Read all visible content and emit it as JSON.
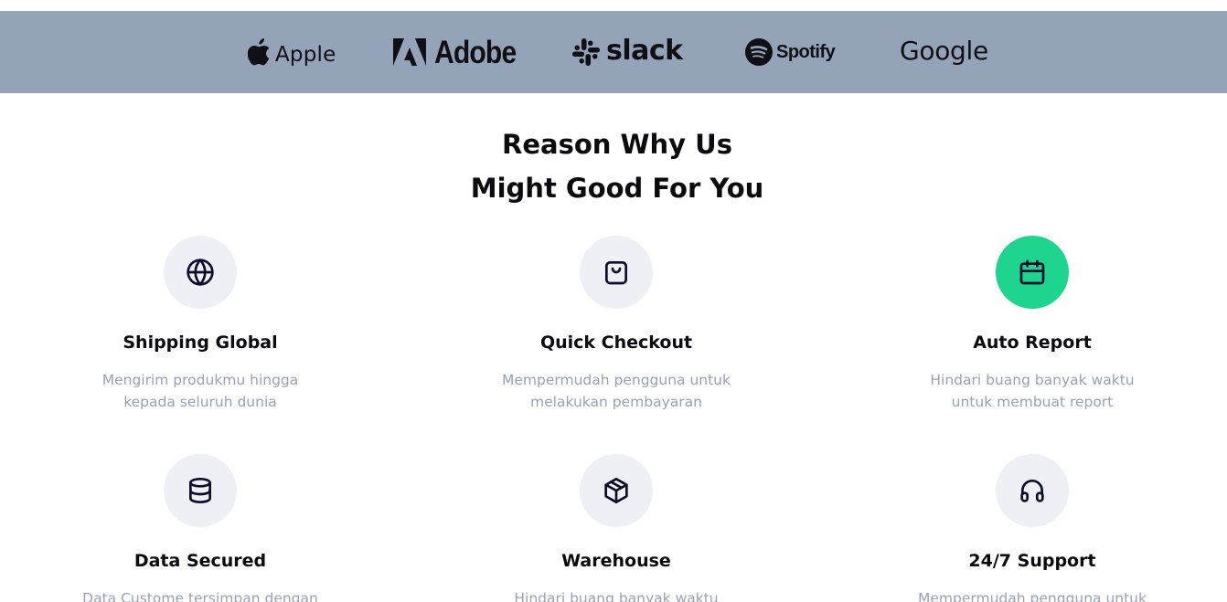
{
  "brands": {
    "apple": {
      "name": "Apple",
      "icon": "apple-logo-icon"
    },
    "adobe": {
      "name": "Adobe",
      "icon": "adobe-logo-icon"
    },
    "slack": {
      "name": "slack",
      "icon": "slack-logo-icon"
    },
    "spotify": {
      "name": "Spotify",
      "icon": "spotify-logo-icon"
    },
    "google": {
      "name": "Google"
    }
  },
  "section": {
    "title_line1": "Reason Why Us",
    "title_line2": "Might Good For You"
  },
  "features": [
    {
      "title": "Shipping Global",
      "desc_line1": "Mengirim produkmu hingga",
      "desc_line2": "kepada seluruh dunia",
      "icon": "globe-icon"
    },
    {
      "title": "Quick Checkout",
      "desc_line1": "Mempermudah pengguna untuk",
      "desc_line2": "melakukan pembayaran",
      "icon": "shopping-bag-icon"
    },
    {
      "title": "Auto Report",
      "desc_line1": "Hindari buang banyak waktu",
      "desc_line2": "untuk membuat report",
      "icon": "calendar-icon",
      "active": true
    },
    {
      "title": "Data Secured",
      "desc_line1": "Data Custome tersimpan dengan",
      "desc_line2": "",
      "icon": "database-icon"
    },
    {
      "title": "Warehouse",
      "desc_line1": "Hindari buang banyak waktu",
      "desc_line2": "",
      "icon": "package-icon"
    },
    {
      "title": "24/7 Support",
      "desc_line1": "Mempermudah pengguna untuk",
      "desc_line2": "",
      "icon": "headphones-icon"
    }
  ],
  "colors": {
    "brand_bar": "#94a3b8",
    "accent": "#1ed58f",
    "icon_circle": "#eef0f6",
    "muted_text": "#9aa1b5",
    "heading_text": "#0a0a0f"
  }
}
